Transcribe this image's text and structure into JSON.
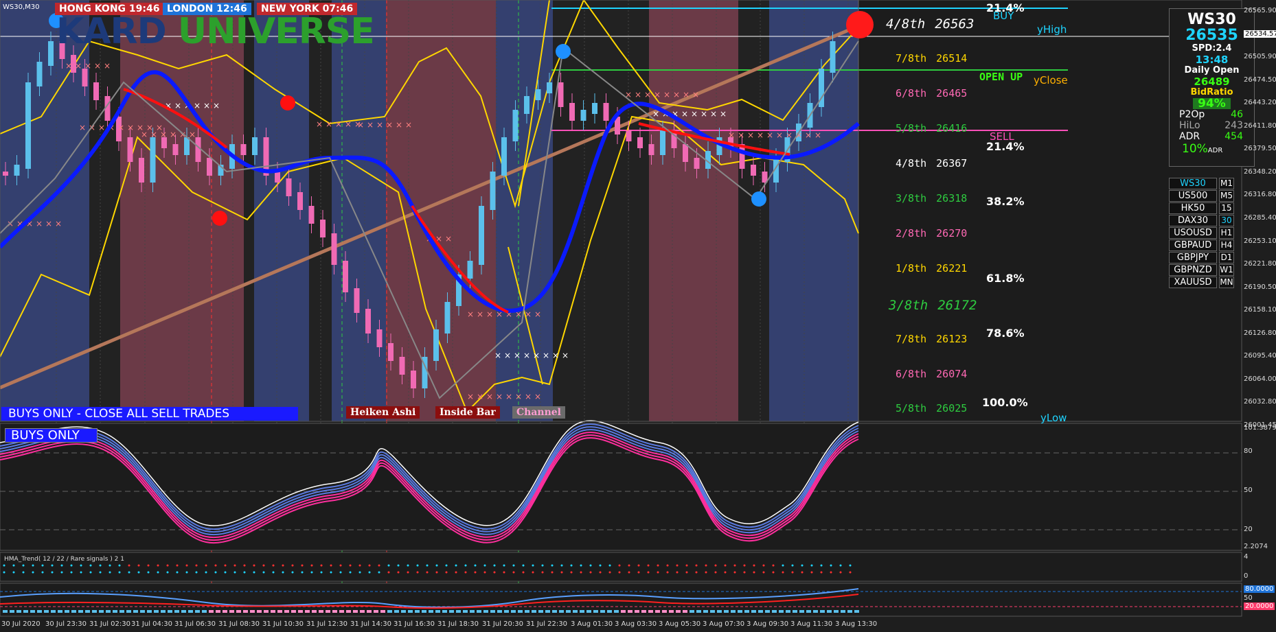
{
  "window": {
    "symbol_tf": "WS30,M30"
  },
  "clocks": [
    {
      "city": "HONG KONG",
      "time": "19:46",
      "bg": "#c0282d"
    },
    {
      "city": "LONDON",
      "time": "12:46",
      "bg": "#1e73d8"
    },
    {
      "city": "NEW YORK",
      "time": "07:46",
      "bg": "#c0282d"
    }
  ],
  "logo": "KARD UNIVERSE",
  "status": {
    "main_banner": "BUYS ONLY - CLOSE ALL SELL TRADES",
    "sub_banner": "BUYS ONLY"
  },
  "tags": [
    "Heiken Ashi",
    "Inside Bar",
    "Channel"
  ],
  "levels": {
    "murrey": [
      {
        "label": "4/8th",
        "value": "26563",
        "color": "#ffffff"
      },
      {
        "label": "7/8th",
        "value": "26514",
        "color": "#ffd700"
      },
      {
        "label": "6/8th",
        "value": "26465",
        "color": "#ff69b4"
      },
      {
        "label": "5/8th",
        "value": "26416",
        "color": "#2ecc40"
      },
      {
        "label": "4/8th",
        "value": "26367",
        "color": "#ffffff"
      },
      {
        "label": "3/8th",
        "value": "26318",
        "color": "#2ecc40"
      },
      {
        "label": "2/8th",
        "value": "26270",
        "color": "#ff69b4"
      },
      {
        "label": "1/8th",
        "value": "26221",
        "color": "#ffd700"
      },
      {
        "label": "3/8th",
        "value": "26172",
        "color": "#2ecc40"
      },
      {
        "label": "7/8th",
        "value": "26123",
        "color": "#ffd700"
      },
      {
        "label": "6/8th",
        "value": "26074",
        "color": "#ff69b4"
      },
      {
        "label": "5/8th",
        "value": "26025",
        "color": "#2ecc40"
      }
    ],
    "fib": [
      "21.4%",
      "21.4%",
      "38.2%",
      "61.8%",
      "78.6%",
      "100.0%"
    ],
    "markers": {
      "buy": "BUY",
      "sell": "SELL",
      "open_up": "OPEN UP",
      "y_high": "yHigh",
      "y_close": "yClose",
      "y_low": "yLow"
    }
  },
  "panel": {
    "symbol": "WS30",
    "price": "26535",
    "spread": "SPD:2.4",
    "time": "13:48",
    "daily_open_label": "Daily Open",
    "daily_open": "26489",
    "bidratio_label": "BidRatio",
    "bidratio": "94%",
    "p2op_label": "P2Op",
    "p2op": "46",
    "hilo_label": "HiLo",
    "hilo": "243",
    "adr_label": "ADR",
    "adr": "454",
    "adr_pct": "10%",
    "adr_suffix": "ADR"
  },
  "symbols": [
    {
      "name": "WS30",
      "tf": "M1"
    },
    {
      "name": "US500",
      "tf": "M5"
    },
    {
      "name": "HK50",
      "tf": "15"
    },
    {
      "name": "DAX30",
      "tf": "30"
    },
    {
      "name": "USOUSD",
      "tf": "H1"
    },
    {
      "name": "GBPAUD",
      "tf": "H4"
    },
    {
      "name": "GBPJPY",
      "tf": "D1"
    },
    {
      "name": "GBPNZD",
      "tf": "W1"
    },
    {
      "name": "XAUUSD",
      "tf": "MN"
    }
  ],
  "price_axis": [
    "26565.90",
    "26534.57",
    "26505.90",
    "26474.50",
    "26443.20",
    "26411.80",
    "26379.50",
    "26348.20",
    "26316.80",
    "26285.40",
    "26253.10",
    "26221.80",
    "26190.50",
    "26158.10",
    "26126.80",
    "26095.40",
    "26064.00",
    "26032.80",
    "26001.45"
  ],
  "osc_axis": [
    "101.3879",
    "80",
    "50",
    "20",
    "2.2074"
  ],
  "hma": {
    "label": "HMA_Trend( 12 / 22 / Rare signals ) 2 1",
    "axis": [
      "4",
      "0"
    ]
  },
  "bottom_axis": [
    "80.0000",
    "50",
    "20.0000"
  ],
  "time_axis": [
    "30 Jul 2020",
    "30 Jul 23:30",
    "31 Jul 02:30",
    "31 Jul 04:30",
    "31 Jul 06:30",
    "31 Jul 08:30",
    "31 Jul 10:30",
    "31 Jul 12:30",
    "31 Jul 14:30",
    "31 Jul 16:30",
    "31 Jul 18:30",
    "31 Jul 20:30",
    "31 Jul 22:30",
    "3 Aug 01:30",
    "3 Aug 03:30",
    "3 Aug 05:30",
    "3 Aug 07:30",
    "3 Aug 09:30",
    "3 Aug 11:30",
    "3 Aug 13:30"
  ],
  "colors": {
    "bull": "#5bc0eb",
    "bear": "#f06ab4",
    "ma_up": "#0a1aff",
    "ma_down": "#ff1010",
    "band": "#ffd700"
  }
}
